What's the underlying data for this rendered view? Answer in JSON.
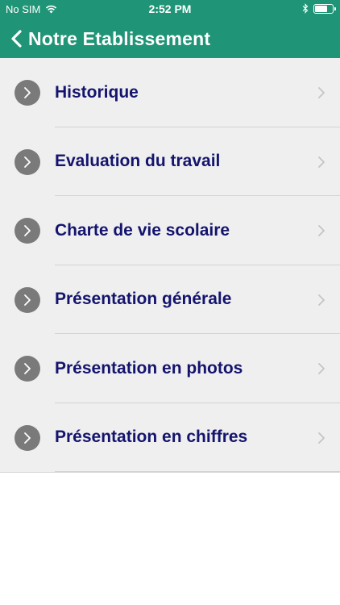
{
  "status_bar": {
    "carrier": "No SIM",
    "time": "2:52 PM",
    "battery_level": 0.7
  },
  "nav": {
    "title": "Notre Etablissement",
    "back_icon": "chevron-left-icon"
  },
  "colors": {
    "header": "#1f9476",
    "label": "#14146e",
    "row_background": "#efefef",
    "row_icon": "#7a7a7a"
  },
  "menu": {
    "items": [
      {
        "label": "Historique"
      },
      {
        "label": "Evaluation du travail"
      },
      {
        "label": "Charte de vie scolaire"
      },
      {
        "label": "Présentation générale"
      },
      {
        "label": "Présentation en photos"
      },
      {
        "label": "Présentation en chiffres"
      }
    ]
  }
}
